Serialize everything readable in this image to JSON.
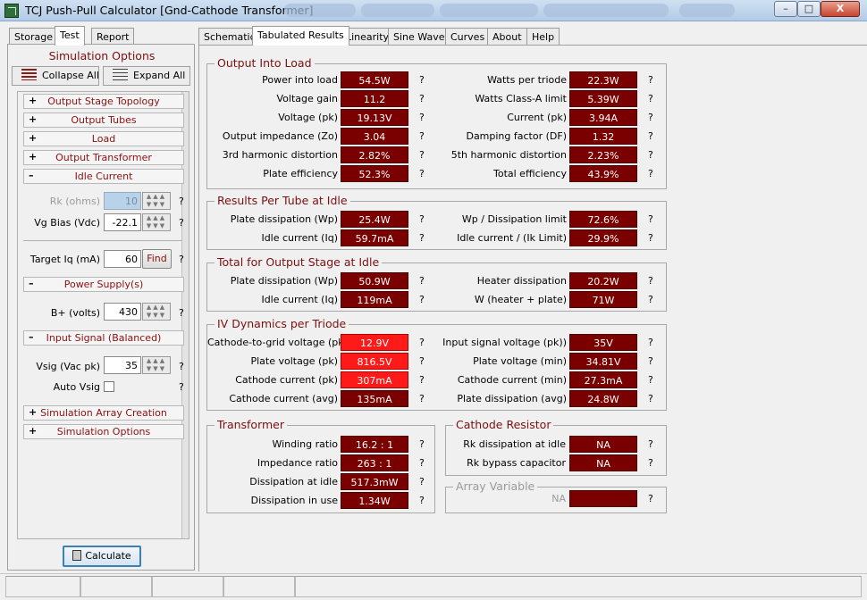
{
  "window": {
    "title": "TCJ Push-Pull Calculator [Gnd-Cathode Transformer]",
    "min": "–",
    "max": "□",
    "close": "X"
  },
  "left_tabs": [
    "Storage",
    "Test",
    "Report"
  ],
  "right_tabs": [
    "Schematic",
    "Tabulated Results",
    "Linearity",
    "Sine Wave",
    "Curves",
    "About",
    "Help"
  ],
  "sim": {
    "title": "Simulation Options",
    "collapse": "Collapse All",
    "expand": "Expand All",
    "sections": {
      "s1": "Output Stage Topology",
      "s2": "Output Tubes",
      "s3": "Load",
      "s4": "Output Transformer",
      "s5": "Idle Current",
      "s6": "Power Supply(s)",
      "s7": "Input Signal (Balanced)",
      "s8": "Simulation Array Creation",
      "s9": "Simulation Options"
    },
    "plus": "+",
    "minus": "–",
    "rk_label": "Rk (ohms)",
    "rk_value": "10",
    "vg_label": "Vg Bias (Vdc)",
    "vg_value": "-22.1",
    "target_label": "Target Iq (mA)",
    "target_value": "60",
    "find": "Find",
    "bplus_label": "B+ (volts)",
    "bplus_value": "430",
    "vsig_label": "Vsig (Vac pk)",
    "vsig_value": "35",
    "autovsig_label": "Auto Vsig",
    "q": "?",
    "calculate": "Calculate"
  },
  "results": {
    "g1": {
      "title": "Output Into Load",
      "l": [
        [
          "Power into load",
          "54.5W"
        ],
        [
          "Voltage gain",
          "11.2"
        ],
        [
          "Voltage (pk)",
          "19.13V"
        ],
        [
          "Output impedance (Zo)",
          "3.04"
        ],
        [
          "3rd harmonic distortion",
          "2.82%"
        ],
        [
          "Plate efficiency",
          "52.3%"
        ]
      ],
      "r": [
        [
          "Watts per triode",
          "22.3W"
        ],
        [
          "Watts Class-A limit",
          "5.39W"
        ],
        [
          "Current (pk)",
          "3.94A"
        ],
        [
          "Damping factor (DF)",
          "1.32"
        ],
        [
          "5th harmonic distortion",
          "2.23%"
        ],
        [
          "Total efficiency",
          "43.9%"
        ]
      ]
    },
    "g2": {
      "title": "Results Per Tube at Idle",
      "l": [
        [
          "Plate dissipation (Wp)",
          "25.4W"
        ],
        [
          "Idle current (Iq)",
          "59.7mA"
        ]
      ],
      "r": [
        [
          "Wp / Dissipation limit",
          "72.6%"
        ],
        [
          "Idle current / (Ik Limit)",
          "29.9%"
        ]
      ]
    },
    "g3": {
      "title": "Total for Output Stage at Idle",
      "l": [
        [
          "Plate dissipation (Wp)",
          "50.9W"
        ],
        [
          "Idle current (Iq)",
          "119mA"
        ]
      ],
      "r": [
        [
          "Heater dissipation",
          "20.2W"
        ],
        [
          "W (heater + plate)",
          "71W"
        ]
      ]
    },
    "g4": {
      "title": "IV Dynamics per Triode",
      "l": [
        [
          "Cathode-to-grid voltage (pk)",
          "12.9V"
        ],
        [
          "Plate voltage (pk)",
          "816.5V"
        ],
        [
          "Cathode current (pk)",
          "307mA"
        ],
        [
          "Cathode current (avg)",
          "135mA"
        ]
      ],
      "r": [
        [
          "Input signal voltage (pk))",
          "35V"
        ],
        [
          "Plate voltage (min)",
          "34.81V"
        ],
        [
          "Cathode current (min)",
          "27.3mA"
        ],
        [
          "Plate dissipation (avg)",
          "24.8W"
        ]
      ]
    },
    "g5": {
      "title": "Transformer",
      "l": [
        [
          "Winding ratio",
          "16.2 : 1"
        ],
        [
          "Impedance ratio",
          "263 : 1"
        ],
        [
          "Dissipation at idle",
          "517.3mW"
        ],
        [
          "Dissipation in use",
          "1.34W"
        ]
      ]
    },
    "g6": {
      "title": "Cathode Resistor",
      "l": [
        [
          "Rk dissipation at idle",
          "NA"
        ],
        [
          "Rk bypass capacitor",
          "NA"
        ]
      ]
    },
    "g7": {
      "title": "Array Variable",
      "value": "NA"
    },
    "q": "?"
  },
  "colors": {
    "value_bg": "#7a0000",
    "value_warn": "#ff1a1a",
    "title": "#7a1010"
  }
}
